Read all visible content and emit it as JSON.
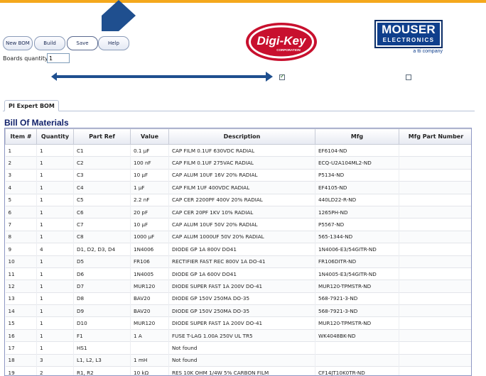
{
  "toolbar": {
    "new_bom": "New BOM",
    "build": "Build",
    "save": "Save",
    "help": "Help"
  },
  "boards_quantity": {
    "label": "Boards quantity:",
    "value": "1"
  },
  "vendors": {
    "digikey": {
      "name": "Digi-Key",
      "sub": "CORPORATION",
      "checked": true
    },
    "mouser": {
      "name": "MOUSER",
      "sub": "ELECTRONICS",
      "tag": "a tti company",
      "checked": false
    }
  },
  "tab_label": "PI Expert BOM",
  "section_title": "Bill Of Materials",
  "colors": {
    "top_bar": "#f4a81c",
    "arrow": "#1f4f8f",
    "digikey_red": "#c8102e",
    "mouser_blue": "#0f3f8c",
    "title_blue": "#10206a"
  },
  "table": {
    "columns": [
      "Item #",
      "Quantity",
      "Part Ref",
      "Value",
      "Description",
      "Mfg",
      "Mfg Part Number"
    ],
    "rows": [
      [
        "1",
        "1",
        "C1",
        "0.1 µF",
        "CAP FILM 0.1UF 630VDC RADIAL",
        "EF6104-ND",
        ""
      ],
      [
        "2",
        "1",
        "C2",
        "100 nF",
        "CAP FILM 0.1UF 275VAC RADIAL",
        "ECQ-U2A104ML2-ND",
        ""
      ],
      [
        "3",
        "1",
        "C3",
        "10 µF",
        "CAP ALUM 10UF 16V 20% RADIAL",
        "P5134-ND",
        ""
      ],
      [
        "4",
        "1",
        "C4",
        "1 µF",
        "CAP FILM 1UF 400VDC RADIAL",
        "EF4105-ND",
        ""
      ],
      [
        "5",
        "1",
        "C5",
        "2.2 nF",
        "CAP CER 2200PF 400V 20% RADIAL",
        "440LD22-R-ND",
        ""
      ],
      [
        "6",
        "1",
        "C6",
        "20 pF",
        "CAP CER 20PF 1KV 10% RADIAL",
        "1265PH-ND",
        ""
      ],
      [
        "7",
        "1",
        "C7",
        "10 µF",
        "CAP ALUM 10UF 50V 20% RADIAL",
        "P5567-ND",
        ""
      ],
      [
        "8",
        "1",
        "C8",
        "1000 µF",
        "CAP ALUM 1000UF 50V 20% RADIAL",
        "565-1344-ND",
        ""
      ],
      [
        "9",
        "4",
        "D1, D2, D3, D4",
        "1N4006",
        "DIODE GP 1A 800V DO41",
        "1N4006-E3/54GITR-ND",
        ""
      ],
      [
        "10",
        "1",
        "D5",
        "FR106",
        "RECTIFIER FAST REC 800V 1A DO-41",
        "FR106DITR-ND",
        ""
      ],
      [
        "11",
        "1",
        "D6",
        "1N4005",
        "DIODE GP 1A 600V DO41",
        "1N4005-E3/54GITR-ND",
        ""
      ],
      [
        "12",
        "1",
        "D7",
        "MUR120",
        "DIODE SUPER FAST 1A 200V DO-41",
        "MUR120-TPMSTR-ND",
        ""
      ],
      [
        "13",
        "1",
        "D8",
        "BAV20",
        "DIODE GP 150V 250MA DO-35",
        "568-7921-3-ND",
        ""
      ],
      [
        "14",
        "1",
        "D9",
        "BAV20",
        "DIODE GP 150V 250MA DO-35",
        "568-7921-3-ND",
        ""
      ],
      [
        "15",
        "1",
        "D10",
        "MUR120",
        "DIODE SUPER FAST 1A 200V DO-41",
        "MUR120-TPMSTR-ND",
        ""
      ],
      [
        "16",
        "1",
        "F1",
        "1 A",
        "FUSE T-LAG 1.00A 250V UL TR5",
        "WK4048BK-ND",
        ""
      ],
      [
        "17",
        "1",
        "HS1",
        "",
        "Not found",
        "",
        ""
      ],
      [
        "18",
        "3",
        "L1, L2, L3",
        "1 mH",
        "Not found",
        "",
        ""
      ],
      [
        "19",
        "2",
        "R1, R2",
        "10 kΩ",
        "RES 10K OHM 1/4W 5% CARBON FILM",
        "CF14JT10K0TR-ND",
        ""
      ]
    ]
  }
}
